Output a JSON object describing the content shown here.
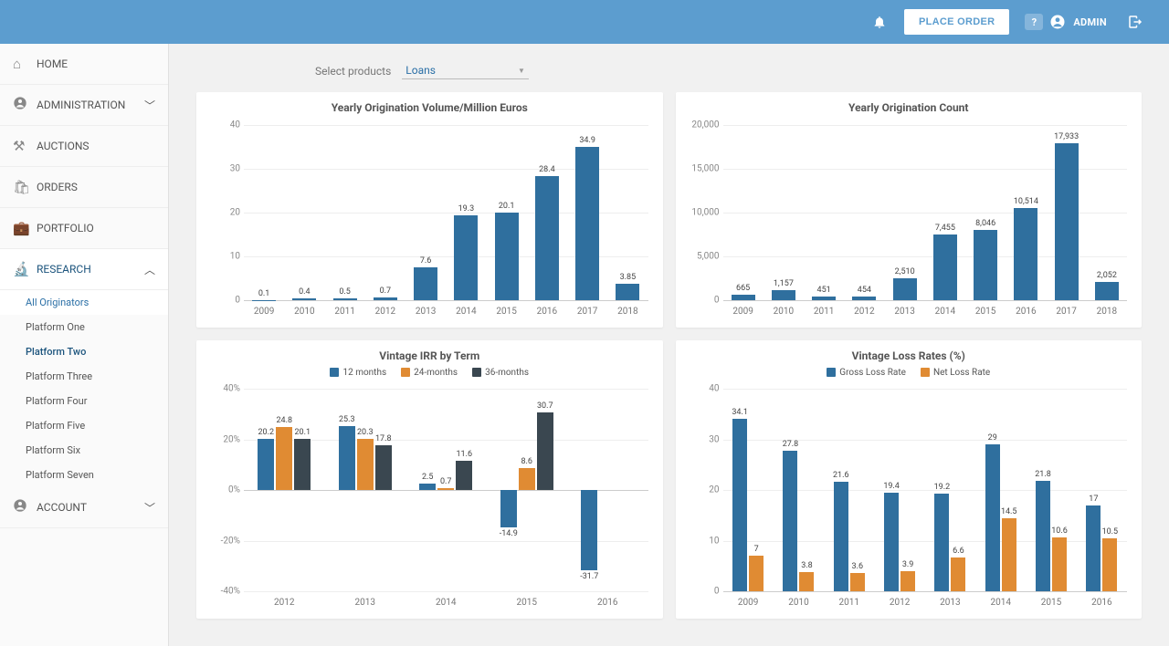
{
  "topbar": {
    "place_order": "PLACE ORDER",
    "chat_badge": "?",
    "user_label": "ADMIN"
  },
  "sidebar": {
    "home": "HOME",
    "administration": "ADMINISTRATION",
    "auctions": "AUCTIONS",
    "orders": "ORDERS",
    "portfolio": "PORTFOLIO",
    "research": "RESEARCH",
    "account": "ACCOUNT",
    "research_items": [
      "All Originators",
      "Platform One",
      "Platform Two",
      "Platform Three",
      "Platform Four",
      "Platform Five",
      "Platform Six",
      "Platform Seven"
    ]
  },
  "filter": {
    "label": "Select products",
    "value": "Loans"
  },
  "colors": {
    "blue": "#2f6f9e",
    "orange": "#e08b33",
    "dark": "#3a4750"
  },
  "chart_data": [
    {
      "type": "bar",
      "title": "Yearly Origination Volume/Million Euros",
      "categories": [
        "2009",
        "2010",
        "2011",
        "2012",
        "2013",
        "2014",
        "2015",
        "2016",
        "2017",
        "2018"
      ],
      "values": [
        0.1,
        0.4,
        0.5,
        0.7,
        7.6,
        19.3,
        20.1,
        28.4,
        34.9,
        3.85
      ],
      "ylim": [
        0,
        40
      ],
      "yticks": [
        0,
        10,
        20,
        30,
        40
      ]
    },
    {
      "type": "bar",
      "title": "Yearly Origination Count",
      "categories": [
        "2009",
        "2010",
        "2011",
        "2012",
        "2013",
        "2014",
        "2015",
        "2016",
        "2017",
        "2018"
      ],
      "values": [
        665,
        1157,
        451,
        454,
        2510,
        7455,
        8046,
        10514,
        17933,
        2052
      ],
      "ylim": [
        0,
        20000
      ],
      "yticks": [
        0,
        5000,
        10000,
        15000,
        20000
      ]
    },
    {
      "type": "bar",
      "title": "Vintage IRR by Term",
      "categories": [
        "2012",
        "2013",
        "2014",
        "2015",
        "2016"
      ],
      "series": [
        {
          "name": "12 months",
          "values": [
            20.2,
            25.3,
            2.5,
            -14.9,
            -31.7
          ]
        },
        {
          "name": "24-months",
          "values": [
            24.8,
            20.3,
            0.7,
            8.6,
            null
          ]
        },
        {
          "name": "36-months",
          "values": [
            20.1,
            17.8,
            11.6,
            30.7,
            null
          ]
        }
      ],
      "ylim": [
        -40,
        40
      ],
      "yticks": [
        -40,
        -20,
        0,
        20,
        40
      ],
      "ysuffix": "%",
      "legend_colors": [
        "#2f6f9e",
        "#e08b33",
        "#3a4750"
      ]
    },
    {
      "type": "bar",
      "title": "Vintage Loss Rates (%)",
      "categories": [
        "2009",
        "2010",
        "2011",
        "2012",
        "2013",
        "2014",
        "2015",
        "2016"
      ],
      "series": [
        {
          "name": "Gross Loss Rate",
          "values": [
            34.1,
            27.8,
            21.6,
            19.4,
            19.2,
            29.0,
            21.8,
            17.0
          ]
        },
        {
          "name": "Net Loss Rate",
          "values": [
            7.0,
            3.8,
            3.6,
            3.9,
            6.6,
            14.5,
            10.6,
            10.5
          ]
        }
      ],
      "ylim": [
        0,
        40
      ],
      "yticks": [
        0,
        10,
        20,
        30,
        40
      ],
      "legend_colors": [
        "#2f6f9e",
        "#e08b33"
      ]
    }
  ]
}
